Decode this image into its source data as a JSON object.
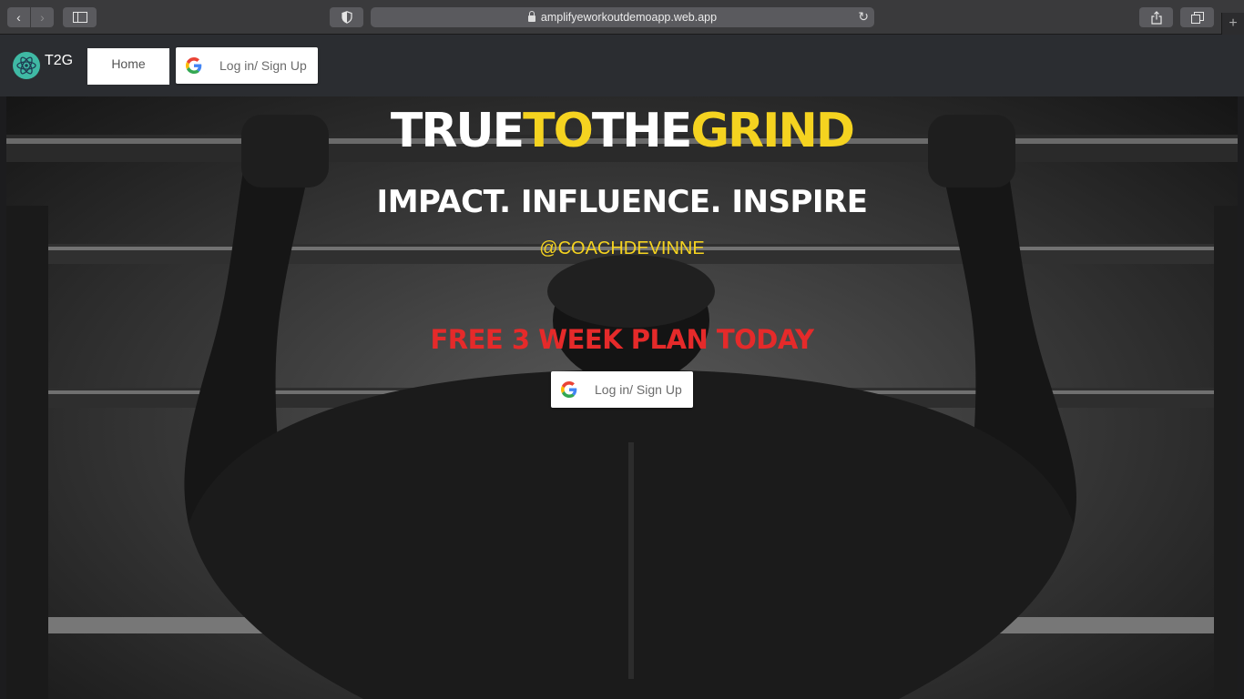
{
  "browser": {
    "url": "amplifyeworkoutdemoapp.web.app",
    "back_glyph": "‹",
    "forward_glyph": "›",
    "reload_glyph": "↻",
    "new_tab_glyph": "+"
  },
  "navbar": {
    "brand": "T2G",
    "home_label": "Home",
    "login_label": "Log in/ Sign Up"
  },
  "hero": {
    "title_parts": [
      "TRUE",
      "TO",
      "THE",
      "GRIND"
    ],
    "tagline": "IMPACT. INFLUENCE. INSPIRE",
    "handle": "@COACHDEVINNE",
    "offer": "FREE 3 WEEK PLAN TODAY",
    "login_label": "Log in/ Sign Up"
  },
  "colors": {
    "accent_yellow": "#f5d320",
    "offer_red": "#e52a2a",
    "navbar_bg": "#2b2d31",
    "logo_teal": "#3fb9a4"
  },
  "icons": [
    "back-arrow-icon",
    "forward-arrow-icon",
    "sidebar-icon",
    "shield-icon",
    "lock-icon",
    "reload-icon",
    "share-icon",
    "tabs-icon",
    "plus-icon",
    "atom-logo-icon",
    "google-g-icon"
  ]
}
